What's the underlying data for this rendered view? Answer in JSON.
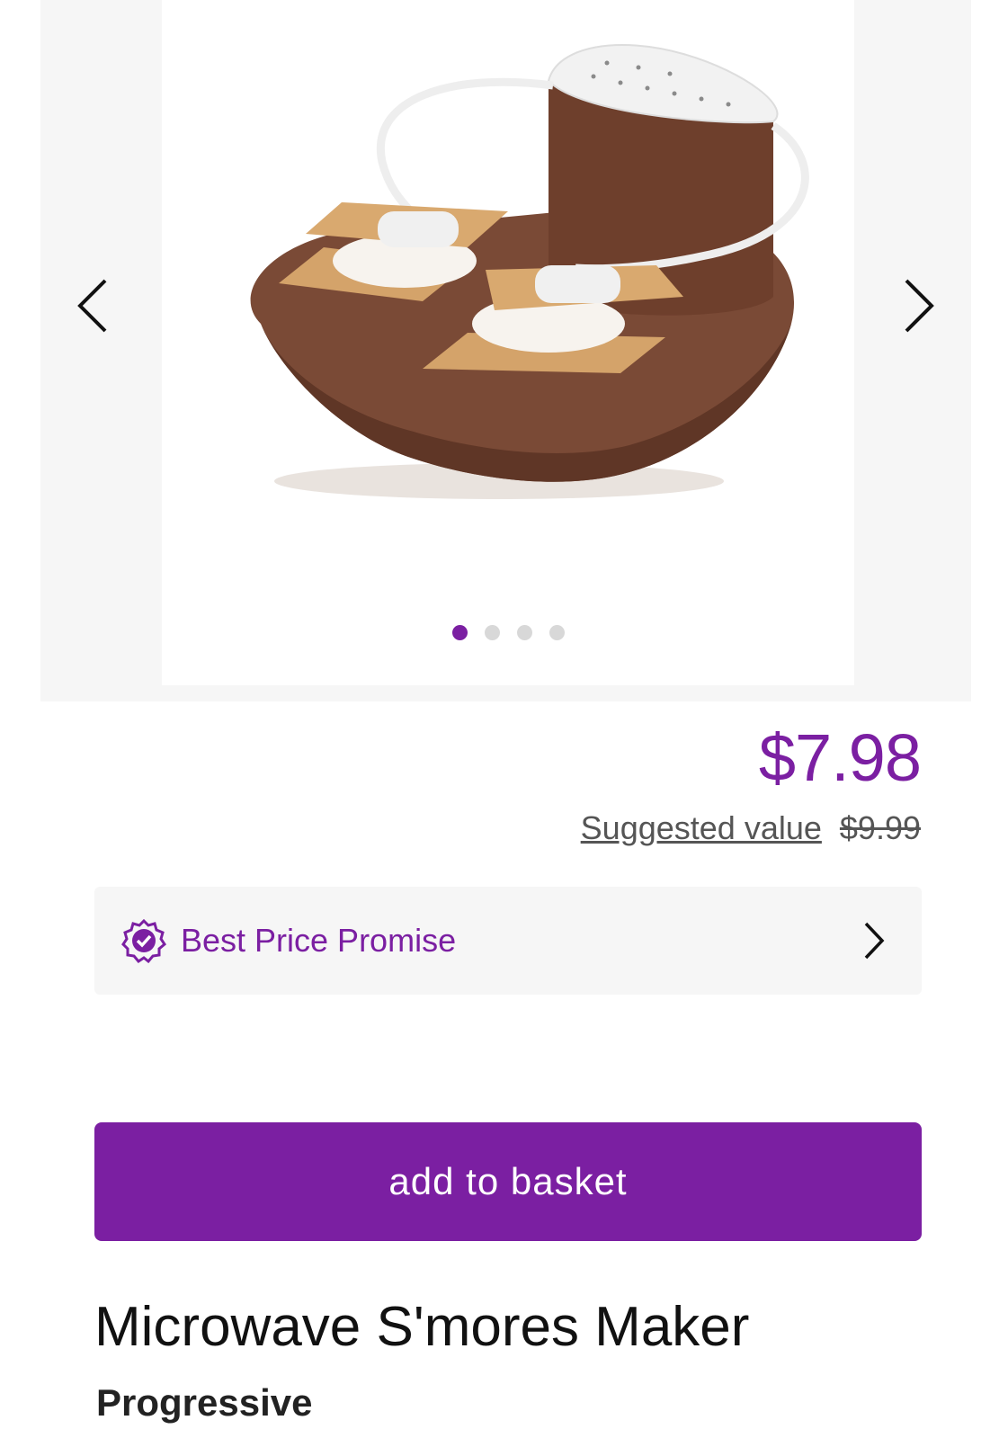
{
  "gallery": {
    "image_alt": "Microwave S'mores Maker product image",
    "slide_count": 4,
    "active_slide": 1,
    "prev_icon": "chevron-left-icon",
    "next_icon": "chevron-right-icon"
  },
  "pricing": {
    "price": "$7.98",
    "suggested_label": "Suggested value",
    "suggested_price": "$9.99"
  },
  "promise": {
    "label": "Best Price Promise",
    "icon": "verified-badge-icon"
  },
  "actions": {
    "add_to_basket": "add to basket"
  },
  "product": {
    "title": "Microwave S'mores Maker",
    "brand": "Progressive"
  },
  "colors": {
    "accent": "#7b1fa2",
    "gallery_bg": "#f6f6f6",
    "dot_inactive": "#d8d8d8"
  }
}
